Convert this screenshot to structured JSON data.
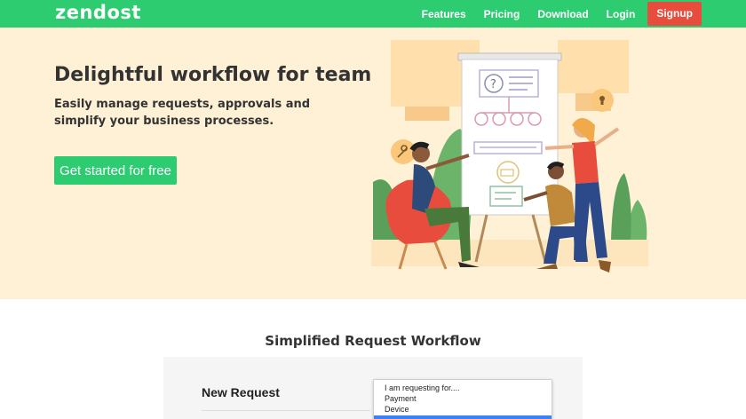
{
  "nav": {
    "logo": "zendost",
    "links": [
      "Features",
      "Pricing",
      "Download",
      "Login"
    ],
    "signup": "Signup"
  },
  "hero": {
    "title": "Delightful workflow for team",
    "subtitle": "Easily manage requests, approvals and simplify your business processes.",
    "cta": "Get started for free"
  },
  "section": {
    "title": "Simplified Request Workflow"
  },
  "demo": {
    "heading": "New Request",
    "dropdown_options": [
      "I am requesting for....",
      "Payment",
      "Device"
    ]
  },
  "colors": {
    "brand_green": "#2ecc71",
    "signup_red": "#e74c3c",
    "hero_bg": "#fff1d6",
    "selected_blue": "#3b82f6"
  }
}
